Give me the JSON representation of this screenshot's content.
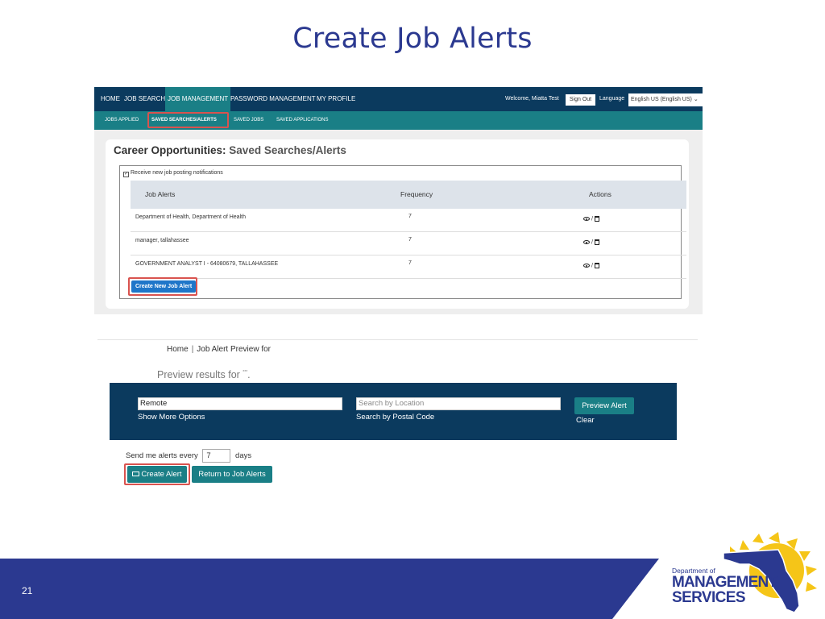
{
  "slide": {
    "title": "Create Job Alerts",
    "page_number": "21",
    "logo": {
      "line1": "Department of",
      "line2": "MANAGEMENT",
      "line3": "SERVICES"
    },
    "colors": {
      "title": "#2b3990",
      "footer_navy": "#2b3990",
      "sun_yellow": "#f5c518",
      "florida_blue": "#2b3990"
    }
  },
  "portal": {
    "topnav": [
      "HOME",
      "JOB SEARCH",
      "JOB MANAGEMENT",
      "PASSWORD MANAGEMENT",
      "MY PROFILE"
    ],
    "active_topnav": "JOB MANAGEMENT",
    "welcome": "Welcome, Miatta Test",
    "signout": "Sign Out",
    "language_label": "Language",
    "language_value": "English US (English US)",
    "subnav": [
      "JOBS APPLIED",
      "SAVED SEARCHES/ALERTS",
      "SAVED JOBS",
      "SAVED APPLICATIONS"
    ],
    "active_subnav": "SAVED SEARCHES/ALERTS",
    "card_title": "Career Opportunities:",
    "card_subtitle": "Saved Searches/Alerts",
    "notify_label": "Receive new job posting notifications",
    "notify_checked": true,
    "table": {
      "headers": [
        "Job Alerts",
        "Frequency",
        "Actions"
      ],
      "rows": [
        {
          "name": "Department of Health, Department of Health",
          "frequency": "7",
          "actions_sep": "/"
        },
        {
          "name": "manager, tallahassee",
          "frequency": "7",
          "actions_sep": "/"
        },
        {
          "name": "GOVERNMENT ANALYST I - 64080679, TALLAHASSEE",
          "frequency": "7",
          "actions_sep": "/"
        }
      ]
    },
    "create_new_button": "Create New Job Alert",
    "colors": {
      "nav": "#0b3a5e",
      "teal": "#1a7f86",
      "primary_button": "#1f76c9",
      "highlight": "#d9534f"
    }
  },
  "preview": {
    "breadcrumb_home": "Home",
    "breadcrumb_sep": "|",
    "breadcrumb_current": "Job Alert Preview for",
    "heading": "Preview results for",
    "heading_suffix": "***",
    "heading_end": ".",
    "keyword_value": "Remote",
    "location_placeholder": "Search by Location",
    "show_more": "Show More Options",
    "postal_code": "Search by Postal Code",
    "preview_button": "Preview Alert",
    "clear": "Clear",
    "send_label": "Send me alerts every",
    "days_value": "7",
    "days_label": "days",
    "create_alert_button": "Create Alert",
    "return_button": "Return to Job Alerts"
  }
}
